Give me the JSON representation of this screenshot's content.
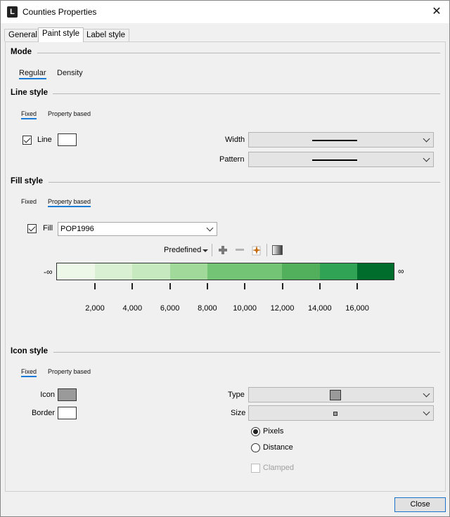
{
  "window": {
    "title": "Counties Properties",
    "app_icon_letter": "L",
    "close_glyph": "✕"
  },
  "tabs": [
    {
      "label": "General",
      "active": false
    },
    {
      "label": "Paint style",
      "active": true
    },
    {
      "label": "Label style",
      "active": false
    }
  ],
  "mode": {
    "title": "Mode",
    "options": [
      {
        "label": "Regular",
        "active": true
      },
      {
        "label": "Density",
        "active": false
      }
    ]
  },
  "line_style": {
    "title": "Line style",
    "subtabs": [
      {
        "label": "Fixed",
        "active": true
      },
      {
        "label": "Property based",
        "active": false
      }
    ],
    "line_checkbox": {
      "label": "Line",
      "checked": true
    },
    "swatch_color": "#ffffff",
    "width_label": "Width",
    "pattern_label": "Pattern"
  },
  "fill_style": {
    "title": "Fill style",
    "subtabs": [
      {
        "label": "Fixed",
        "active": false
      },
      {
        "label": "Property based",
        "active": true
      }
    ],
    "fill_checkbox": {
      "label": "Fill",
      "checked": true
    },
    "property_value": "POP1996",
    "toolbar": {
      "predefined_label": "Predefined",
      "add_icon": "plus-icon",
      "remove_icon": "minus-icon",
      "randomize_icon": "sparkle-icon",
      "gradient_icon": "gradient-icon"
    },
    "ramp": {
      "minus_infinity": "-∞",
      "plus_infinity": "∞",
      "colors": [
        "#edf8e9",
        "#d9f0d3",
        "#c7e9c0",
        "#a1d99b",
        "#74c476",
        "#74c476",
        "#52b05c",
        "#31a354",
        "#006d2c"
      ],
      "breaks": [
        2000,
        4000,
        6000,
        8000,
        10000,
        12000,
        14000,
        16000
      ],
      "break_labels": [
        "2,000",
        "4,000",
        "6,000",
        "8,000",
        "10,000",
        "12,000",
        "14,000",
        "16,000"
      ]
    }
  },
  "icon_style": {
    "title": "Icon style",
    "subtabs": [
      {
        "label": "Fixed",
        "active": true
      },
      {
        "label": "Property based",
        "active": false
      }
    ],
    "icon_label": "Icon",
    "border_label": "Border",
    "icon_color": "#9a9a9a",
    "border_color": "#ffffff",
    "type_label": "Type",
    "size_label": "Size",
    "units": [
      {
        "label": "Pixels",
        "checked": true
      },
      {
        "label": "Distance",
        "checked": false
      }
    ],
    "clamped": {
      "label": "Clamped",
      "checked": false,
      "enabled": false
    }
  },
  "footer": {
    "close_label": "Close"
  }
}
